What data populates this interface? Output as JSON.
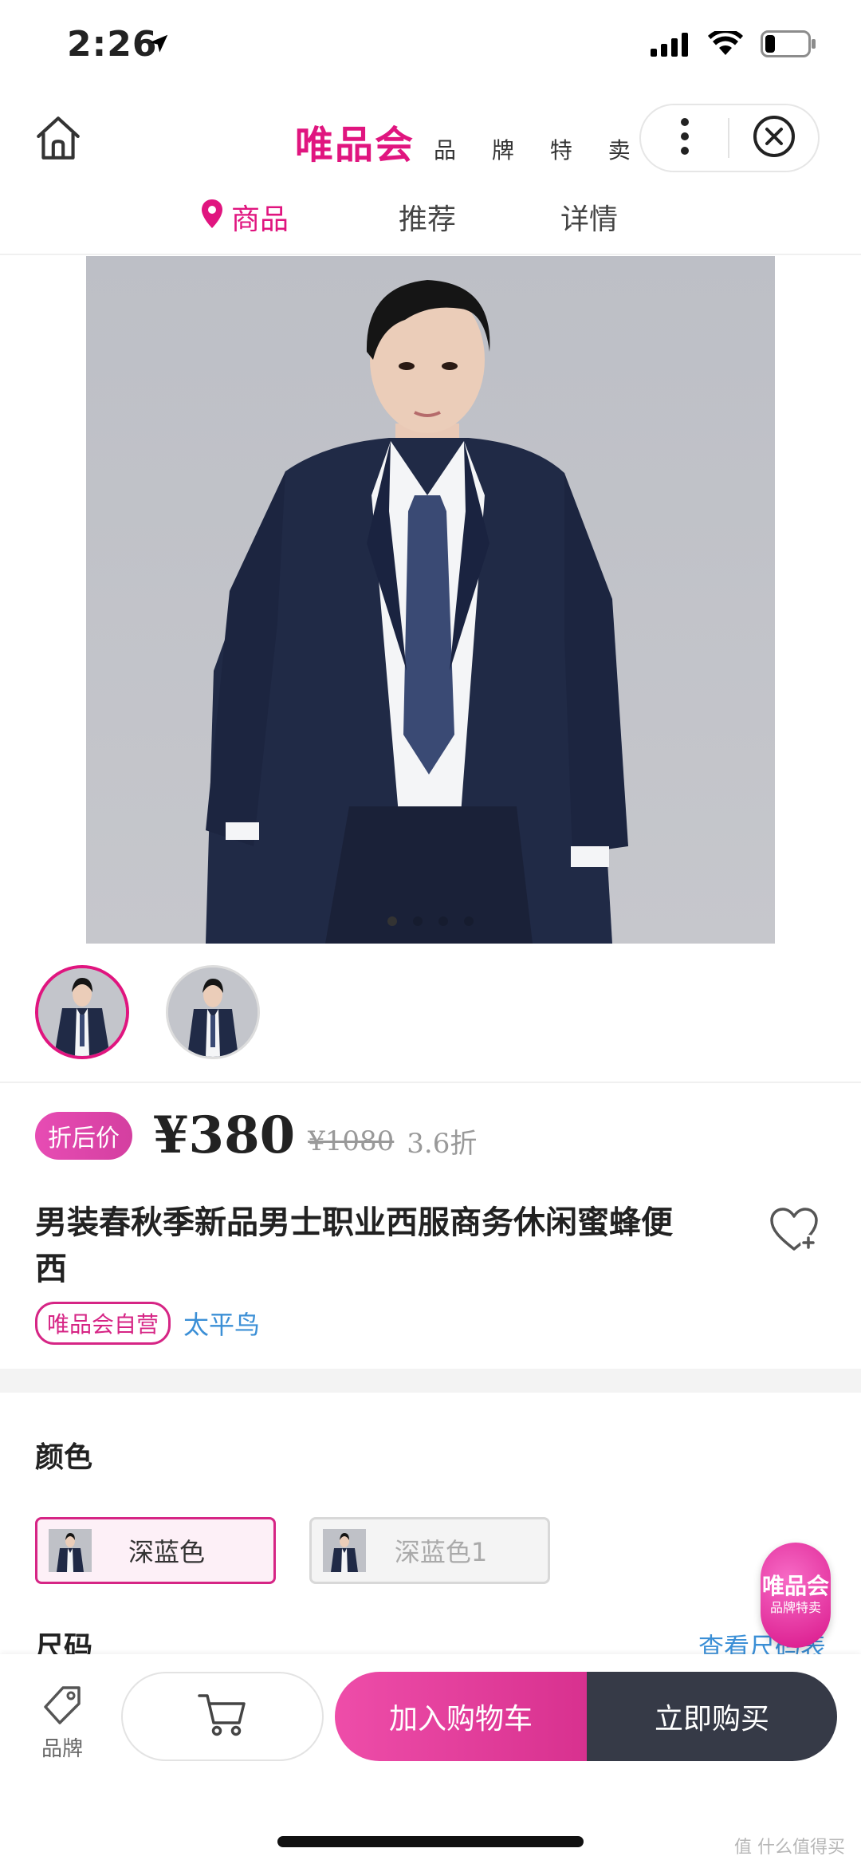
{
  "status": {
    "time": "2:26"
  },
  "header": {
    "logo": "唯品会",
    "subtitle": "品 牌 特 卖"
  },
  "tabs": [
    {
      "label": "商品",
      "active": true
    },
    {
      "label": "推荐",
      "active": false
    },
    {
      "label": "详情",
      "active": false
    }
  ],
  "gallery": {
    "dot_count": 4,
    "active_dot": 0,
    "thumbnail_count": 2,
    "selected_thumbnail": 0
  },
  "price": {
    "badge": "折后价",
    "current": "¥380",
    "original": "¥1080",
    "discount": "3.6折"
  },
  "product": {
    "title": "男装春秋季新品男士职业西服商务休闲蜜蜂便西",
    "tag_self": "唯品会自营",
    "brand": "太平鸟"
  },
  "options": {
    "color_label": "颜色",
    "colors": [
      {
        "name": "深蓝色",
        "selected": true
      },
      {
        "name": "深蓝色1",
        "selected": false
      }
    ],
    "size_label": "尺码",
    "size_chart_link": "查看尺码表"
  },
  "float_badge": {
    "line1": "唯品会",
    "line2": "品牌特卖"
  },
  "bottom": {
    "brand_label": "品牌",
    "add_to_cart": "加入购物车",
    "buy_now": "立即购买"
  },
  "watermark": "值 什么值得买",
  "colors": {
    "accent": "#e0157f",
    "link": "#3b8fd6",
    "buy": "#363a47"
  }
}
